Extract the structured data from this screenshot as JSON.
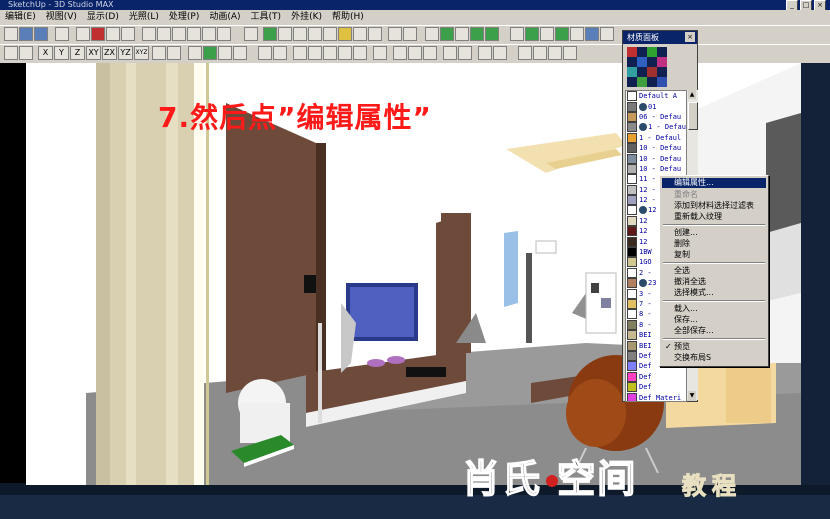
{
  "app": {
    "title": "SketchUp - 3D Studio MAX"
  },
  "menu": {
    "items": [
      "编辑(E)",
      "视图(V)",
      "显示(D)",
      "光照(L)",
      "处理(P)",
      "动画(A)",
      "工具(T)",
      "外挂(K)",
      "帮助(H)"
    ]
  },
  "toolbar2": {
    "view_buttons": [
      "X",
      "Y",
      "Z",
      "XY",
      "ZX",
      "YZ",
      "XYZ"
    ]
  },
  "instruction": {
    "text": "7.然后点”编辑属性”"
  },
  "material_panel": {
    "title": "材质面板",
    "close": "×",
    "rows": [
      {
        "name": "Default A",
        "color": "#ffffff",
        "icon": false
      },
      {
        "name": "01",
        "color": "#7a7a7a",
        "icon": true
      },
      {
        "name": "06 - Defau",
        "color": "#c89a5a",
        "icon": false
      },
      {
        "name": "1 - Defaul",
        "color": "#8a8a8a",
        "icon": true
      },
      {
        "name": "1 - Defaul",
        "color": "#e8a030",
        "icon": false
      },
      {
        "name": "10 - Defau",
        "color": "#606060",
        "icon": false
      },
      {
        "name": "10 - Defau",
        "color": "#8090a0",
        "icon": false
      },
      {
        "name": "10 - Defau",
        "color": "#b0b0b0",
        "icon": false
      },
      {
        "name": "11 - Defau",
        "color": "#ffffff",
        "icon": false
      },
      {
        "name": "12 - Defau",
        "color": "#c0c0c0",
        "icon": false
      },
      {
        "name": "12 - Defau",
        "color": "#a0a0c0",
        "icon": false
      },
      {
        "name": "12",
        "color": "#ffffff",
        "icon": true
      },
      {
        "name": "12",
        "color": "#e0d8c0",
        "icon": false
      },
      {
        "name": "12",
        "color": "#601818",
        "icon": false
      },
      {
        "name": "12",
        "color": "#3a2a20",
        "icon": false
      },
      {
        "name": "1BW",
        "color": "#000000",
        "icon": false
      },
      {
        "name": "1GO",
        "color": "#d0c890",
        "icon": false
      },
      {
        "name": "2 -",
        "color": "#ffffff",
        "icon": false
      },
      {
        "name": "23",
        "color": "#b08060",
        "icon": true
      },
      {
        "name": "3 -",
        "color": "#ffffff",
        "icon": false
      },
      {
        "name": "7 -",
        "color": "#e0c060",
        "icon": false
      },
      {
        "name": "8 -",
        "color": "#ffffff",
        "icon": false
      },
      {
        "name": "8 -",
        "color": "#808060",
        "icon": false
      },
      {
        "name": "BEI",
        "color": "#c8b890",
        "icon": false
      },
      {
        "name": "BEI",
        "color": "#a89870",
        "icon": false
      },
      {
        "name": "Def",
        "color": "#808080",
        "icon": false
      },
      {
        "name": "Def",
        "color": "#8080ff",
        "icon": false
      },
      {
        "name": "Def",
        "color": "#ff40c0",
        "icon": false
      },
      {
        "name": "Def",
        "color": "#c0c020",
        "icon": false
      },
      {
        "name": "Def Materi",
        "color": "#e040e0",
        "icon": false
      },
      {
        "name": "Def Materi",
        "color": "#a0c040",
        "icon": false
      }
    ]
  },
  "context_menu": {
    "items": [
      {
        "label": "编辑属性...",
        "state": "highlight"
      },
      {
        "label": "重命名",
        "state": "disabled"
      },
      {
        "label": "添加到材料选择过滤表",
        "state": "normal"
      },
      {
        "label": "重新载入纹理",
        "state": "normal"
      },
      {
        "label": "创建...",
        "state": "normal"
      },
      {
        "label": "删除",
        "state": "normal"
      },
      {
        "label": "复制",
        "state": "normal"
      },
      {
        "label": "全选",
        "state": "normal"
      },
      {
        "label": "撤消全选",
        "state": "normal"
      },
      {
        "label": "选择模式...",
        "state": "normal"
      },
      {
        "label": "载入...",
        "state": "normal"
      },
      {
        "label": "保存...",
        "state": "normal"
      },
      {
        "label": "全部保存...",
        "state": "normal"
      },
      {
        "label": "预览",
        "state": "checked"
      },
      {
        "label": "交换布局S",
        "state": "normal"
      }
    ],
    "check_mark": "✓"
  },
  "logo": {
    "main": "肖氏 空间",
    "sub": "教程"
  },
  "colors": {
    "instruction": "#ff1a1a",
    "highlight": "#0a246a",
    "panel_bg": "#d4d0c8"
  }
}
